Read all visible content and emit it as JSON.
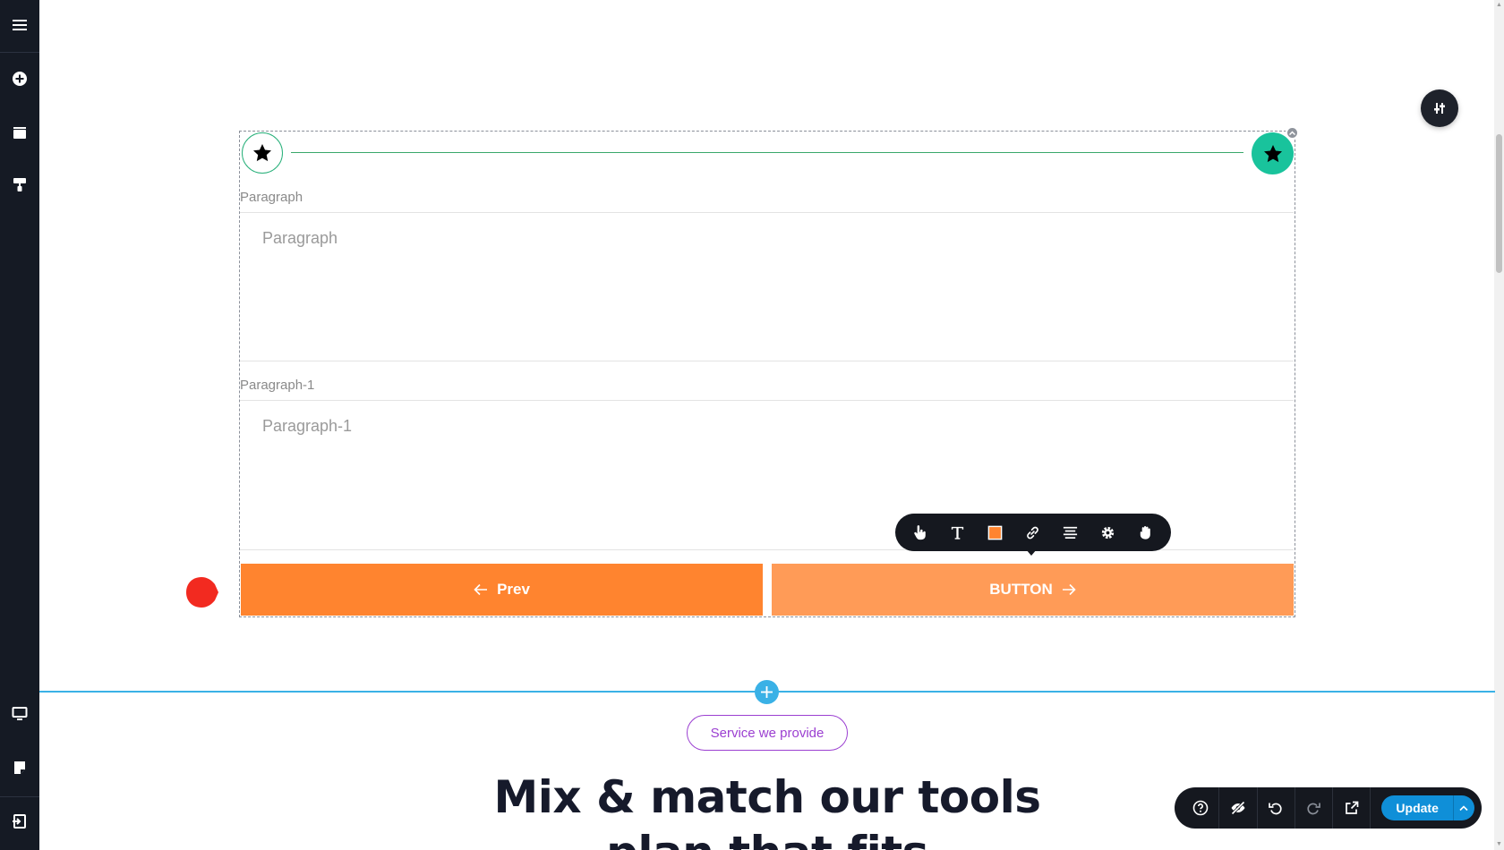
{
  "form": {
    "field1_label": "Paragraph",
    "field1_placeholder": "Paragraph",
    "field2_label": "Paragraph-1",
    "field2_placeholder": "Paragraph-1",
    "prev_label": "Prev",
    "next_label": "BUTTON"
  },
  "section": {
    "pill_label": "Service we provide",
    "heading_line1": "Mix & match our tools",
    "heading_line2": "plan that fits"
  },
  "actionbar": {
    "update_label": "Update"
  },
  "colors": {
    "sidebar": "#151a24",
    "accent_orange": "#ff842f",
    "accent_orange_light": "#ff9b57",
    "step_active": "#19c39c",
    "section_line": "#3ab1e6",
    "pill": "#9b3fd1",
    "update": "#0f8fd8"
  },
  "icons": {
    "sidebar": [
      "menu-icon",
      "add-circle-icon",
      "pages-icon",
      "paint-roller-icon",
      "desktop-icon",
      "notes-icon",
      "exit-icon"
    ],
    "toolbar": [
      "hand-pointer-icon",
      "text-icon",
      "color-square-icon",
      "link-icon",
      "align-icon",
      "gear-icon",
      "drag-hand-icon"
    ],
    "actionbar": [
      "help-icon",
      "hide-icon",
      "undo-icon",
      "redo-icon",
      "external-link-icon"
    ]
  }
}
